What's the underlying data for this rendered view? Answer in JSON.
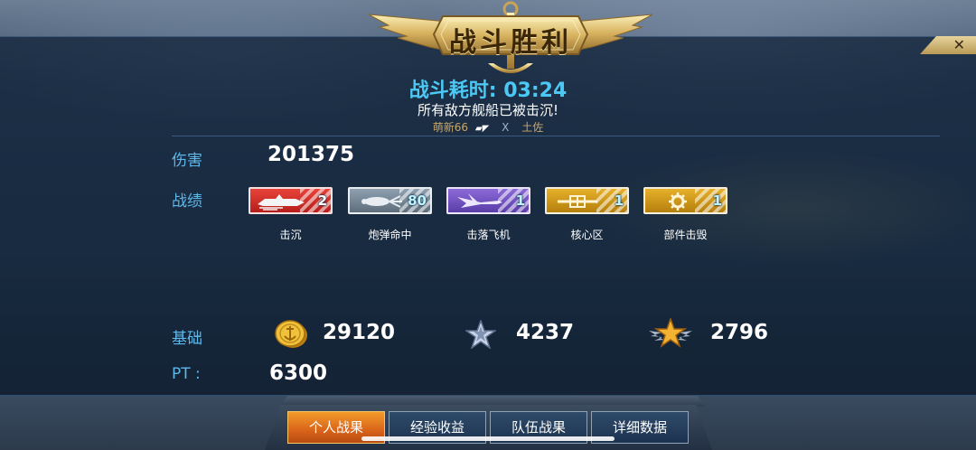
{
  "header": {
    "title": "战斗胜利",
    "battle_time_label": "战斗耗时:",
    "battle_time_value": "03:24",
    "result_message": "所有敌方舰船已被击沉!",
    "player_name": "萌新66",
    "separator": "X",
    "ship_name": "土佐",
    "close_symbol": "✕"
  },
  "stats": {
    "damage_label": "伤害",
    "damage_value": "201375",
    "achievements_label": "战绩",
    "achievements": [
      {
        "label": "击沉",
        "count": "2",
        "color": "#d3302a",
        "icon": "ship-silhouette-icon"
      },
      {
        "label": "炮弹命中",
        "count": "80",
        "color": "#6f8090",
        "icon": "shell-hit-icon"
      },
      {
        "label": "击落飞机",
        "count": "1",
        "color": "#7452c2",
        "icon": "aircraft-icon"
      },
      {
        "label": "核心区",
        "count": "1",
        "color": "#d09a1c",
        "icon": "core-zone-icon"
      },
      {
        "label": "部件击毁",
        "count": "1",
        "color": "#d09a1c",
        "icon": "gear-icon"
      }
    ]
  },
  "rewards": {
    "base_label": "基础",
    "coins_icon": "gold-coin-icon",
    "coins_value": "29120",
    "silver_star_icon": "silver-star-icon",
    "silver_value": "4237",
    "gold_star_icon": "gold-winged-star-icon",
    "gold_value": "2796",
    "pt_label": "PT :",
    "pt_value": "6300"
  },
  "tabs": [
    {
      "label": "个人战果",
      "active": true
    },
    {
      "label": "经验收益",
      "active": false
    },
    {
      "label": "队伍战果",
      "active": false
    },
    {
      "label": "详细数据",
      "active": false
    }
  ],
  "colors": {
    "accent_blue": "#4cc8f5",
    "label_blue": "#5fb8ea",
    "gold": "#d9b45a",
    "active_tab": "#e8781f"
  }
}
